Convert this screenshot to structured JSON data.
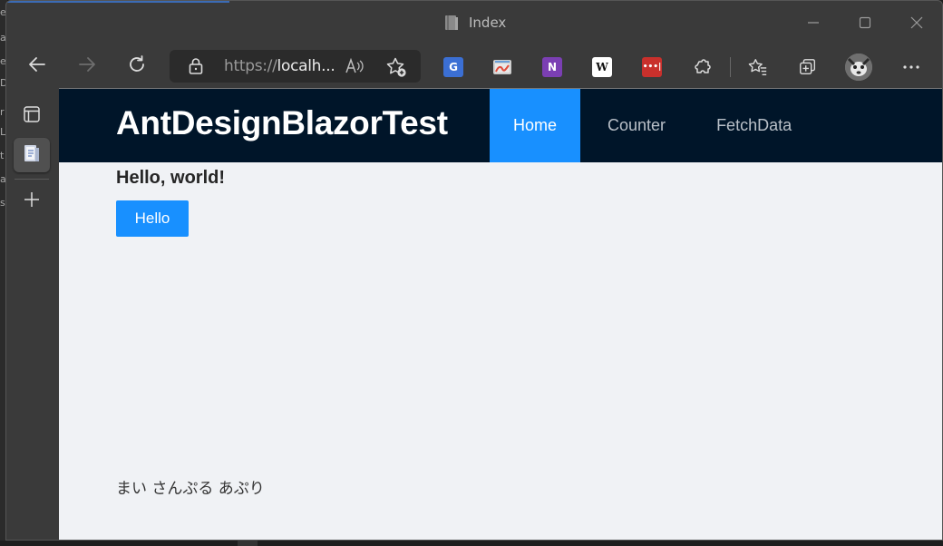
{
  "window": {
    "title": "Index",
    "icons": {
      "page": "book-icon",
      "minimize": "minimize-icon",
      "maximize": "maximize-icon",
      "close": "close-icon"
    }
  },
  "toolbar": {
    "address": {
      "url_prefix": "https://",
      "url_host": "localh..."
    },
    "extensions": {
      "translate": "G",
      "onenote": "N",
      "wiki": "W",
      "red": "•••|"
    }
  },
  "page": {
    "brand": "AntDesignBlazorTest",
    "menu": [
      {
        "label": "Home",
        "selected": true
      },
      {
        "label": "Counter",
        "selected": false
      },
      {
        "label": "FetchData",
        "selected": false
      }
    ],
    "heading": "Hello, world!",
    "button_label": "Hello",
    "footer": "まい さんぷる あぷり"
  },
  "colors": {
    "header_bg": "#001529",
    "primary": "#1890ff",
    "content_bg": "#f0f2f5"
  }
}
